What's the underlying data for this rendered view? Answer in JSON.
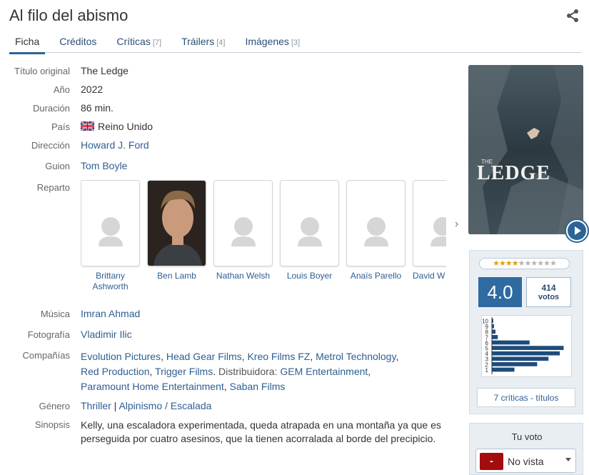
{
  "title": "Al filo del abismo",
  "tabs": [
    {
      "label": "Ficha",
      "count": ""
    },
    {
      "label": "Créditos",
      "count": ""
    },
    {
      "label": "Críticas",
      "count": "[7]"
    },
    {
      "label": "Tráilers",
      "count": "[4]"
    },
    {
      "label": "Imágenes",
      "count": "[3]"
    }
  ],
  "fields": {
    "original_title_label": "Título original",
    "original_title": "The Ledge",
    "year_label": "Año",
    "year": "2022",
    "duration_label": "Duración",
    "duration": "86 min.",
    "country_label": "País",
    "country": "Reino Unido",
    "director_label": "Dirección",
    "director": "Howard J. Ford",
    "screenplay_label": "Guion",
    "screenplay": "Tom Boyle",
    "cast_label": "Reparto",
    "music_label": "Música",
    "music": "Imran Ahmad",
    "photography_label": "Fotografía",
    "photography": "Vladimir Ilic",
    "companies_label": "Compañías",
    "companies": [
      "Evolution Pictures",
      "Head Gear Films",
      "Kreo Films FZ",
      "Metrol Technology",
      "Red Production",
      "Trigger Films",
      "GEM Entertainment",
      "Paramount Home Entertainment",
      "Saban Films"
    ],
    "distributor_label": "Distribuidora:",
    "genre_label": "Género",
    "genres": [
      "Thriller",
      "Alpinismo / Escalada"
    ],
    "synopsis_label": "Sinopsis",
    "synopsis": "Kelly, una escaladora experimentada, queda atrapada en una montaña ya que es perseguida por cuatro asesinos, que la tienen acorralada al borde del precipicio."
  },
  "cast": [
    {
      "name": "Brittany Ashworth",
      "has_photo": false
    },
    {
      "name": "Ben Lamb",
      "has_photo": true
    },
    {
      "name": "Nathan Welsh",
      "has_photo": false
    },
    {
      "name": "Louis Boyer",
      "has_photo": false
    },
    {
      "name": "Anaïs Parello",
      "has_photo": false
    },
    {
      "name": "David W",
      "has_photo": false
    }
  ],
  "poster": {
    "title_text": "LEDGE",
    "prefix": "THE"
  },
  "rating": {
    "average": "4.0",
    "stars_filled": 4,
    "stars_total": 10,
    "votes_count": "414",
    "votes_label": "votos",
    "histogram_labels": [
      "10",
      "9",
      "8",
      "7",
      "6",
      "5",
      "4",
      "3",
      "2",
      "1"
    ],
    "histogram_values": [
      0.02,
      0.03,
      0.05,
      0.08,
      0.5,
      0.95,
      0.9,
      0.75,
      0.6,
      0.3
    ],
    "critics_link": "7 críticas - títulos"
  },
  "my_vote": {
    "title": "Tu voto",
    "badge": "-",
    "value": "No vista"
  },
  "colors": {
    "accent": "#2b6496",
    "link": "#2f5e91",
    "vote_badge": "#a30d0d"
  }
}
